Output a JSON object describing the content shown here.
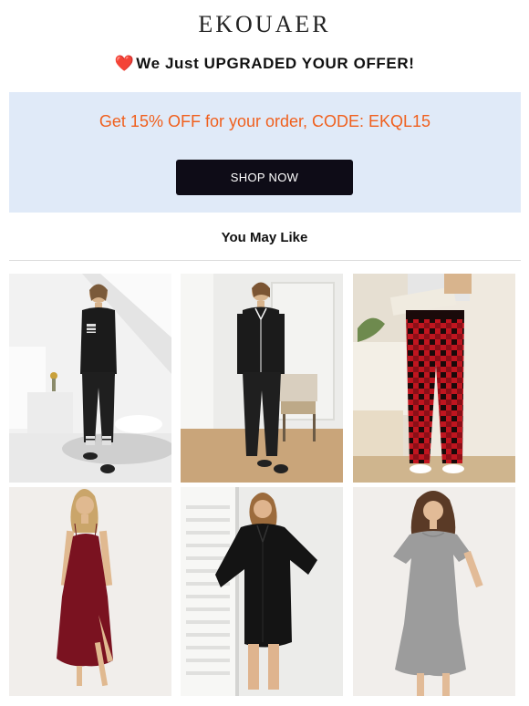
{
  "brand": {
    "logo_text": "EKOUAER"
  },
  "headline": {
    "heart_icon": "❤️",
    "text": "We Just UPGRADED YOUR OFFER!"
  },
  "offer": {
    "text": "Get 15% OFF for your order, CODE: EKQL15",
    "button_label": "SHOP NOW",
    "background_color": "#e0eaf8",
    "text_color": "#f0601e",
    "button_color": "#0e0c17"
  },
  "recommendations": {
    "title": "You May Like",
    "products": [
      {
        "image": "black pajama set with striped trim",
        "color": "#1b1b1b"
      },
      {
        "image": "black button-up pajama set",
        "color": "#1b1b1b"
      },
      {
        "image": "red plaid pajama pants",
        "color": "#b01020"
      },
      {
        "image": "burgundy sleeveless nightgown",
        "color": "#7a1220"
      },
      {
        "image": "black satin sleep shirt",
        "color": "#141414"
      },
      {
        "image": "grey short-sleeve nightgown",
        "color": "#9c9c9c"
      }
    ]
  }
}
